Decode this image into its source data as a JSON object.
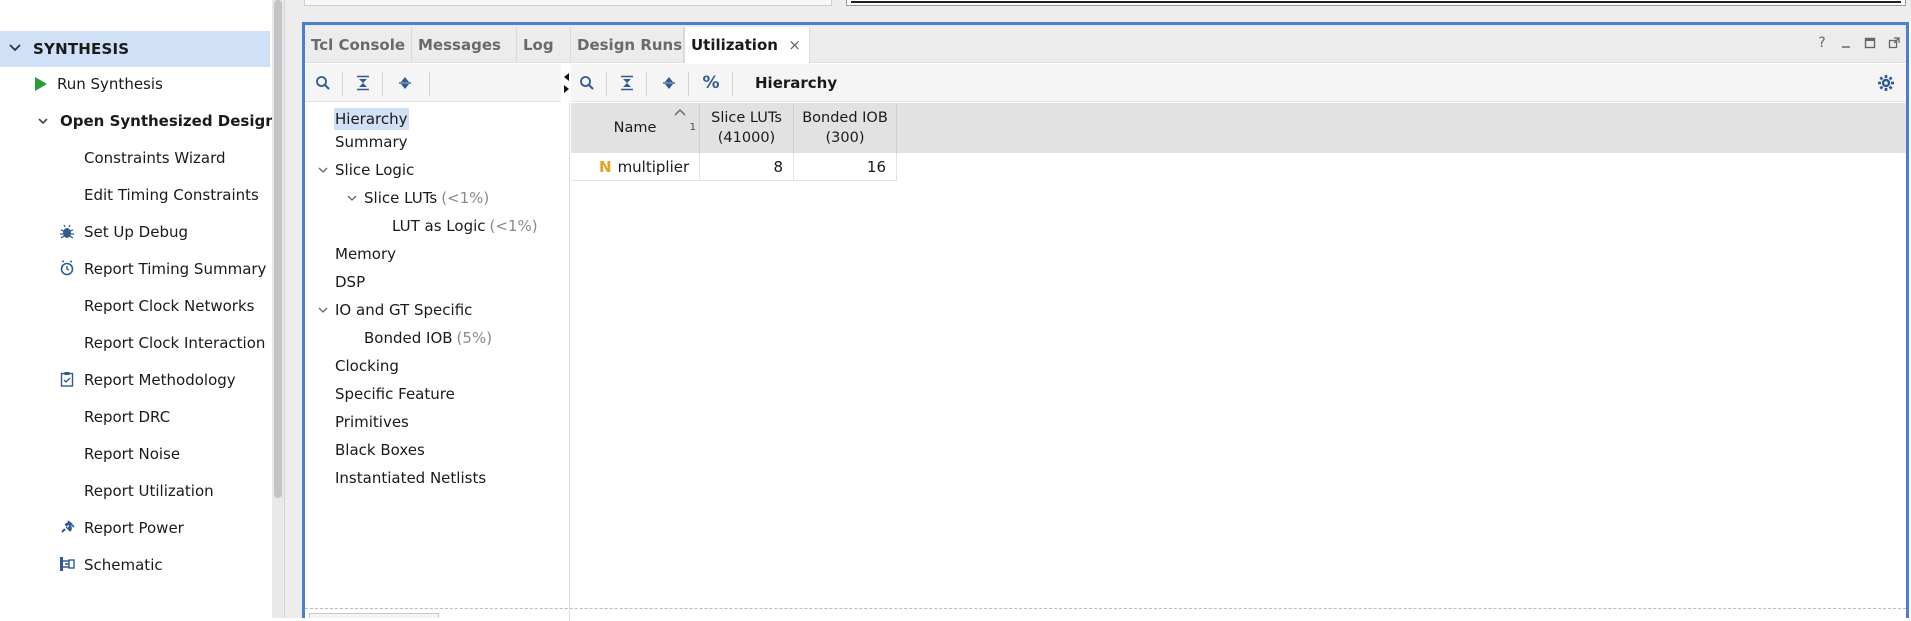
{
  "flow_navigator": {
    "section_title": "SYNTHESIS",
    "items": [
      {
        "label": "Run Synthesis",
        "icon": "run-icon"
      },
      {
        "label": "Open Synthesized Design",
        "icon": "chevron-down-icon"
      },
      {
        "label": "Constraints Wizard",
        "icon": ""
      },
      {
        "label": "Edit Timing Constraints",
        "icon": ""
      },
      {
        "label": "Set Up Debug",
        "icon": "bug-icon"
      },
      {
        "label": "Report Timing Summary",
        "icon": "clock-icon"
      },
      {
        "label": "Report Clock Networks",
        "icon": ""
      },
      {
        "label": "Report Clock Interaction",
        "icon": ""
      },
      {
        "label": "Report Methodology",
        "icon": "clipboard-icon"
      },
      {
        "label": "Report DRC",
        "icon": ""
      },
      {
        "label": "Report Noise",
        "icon": ""
      },
      {
        "label": "Report Utilization",
        "icon": ""
      },
      {
        "label": "Report Power",
        "icon": "power-icon"
      },
      {
        "label": "Schematic",
        "icon": "schematic-icon"
      }
    ]
  },
  "panel": {
    "tabs": [
      {
        "label": "Tcl Console",
        "active": false
      },
      {
        "label": "Messages",
        "active": false
      },
      {
        "label": "Log",
        "active": false
      },
      {
        "label": "Design Runs",
        "active": false
      },
      {
        "label": "Utilization",
        "active": true
      }
    ],
    "close_glyph": "×",
    "window_controls": [
      "?",
      "_",
      "□",
      "⇱"
    ],
    "right_toolbar": {
      "percent_label": "%",
      "view_title": "Hierarchy"
    },
    "tree": [
      {
        "label": "Hierarchy",
        "pct": "",
        "selected": true
      },
      {
        "label": "Summary",
        "pct": ""
      },
      {
        "label": "Slice Logic",
        "pct": ""
      },
      {
        "label": "Slice LUTs",
        "pct": "(<1%)"
      },
      {
        "label": "LUT as Logic",
        "pct": "(<1%)"
      },
      {
        "label": "Memory",
        "pct": ""
      },
      {
        "label": "DSP",
        "pct": ""
      },
      {
        "label": "IO and GT Specific",
        "pct": ""
      },
      {
        "label": "Bonded IOB",
        "pct": "(5%)"
      },
      {
        "label": "Clocking",
        "pct": ""
      },
      {
        "label": "Specific Feature",
        "pct": ""
      },
      {
        "label": "Primitives",
        "pct": ""
      },
      {
        "label": "Black Boxes",
        "pct": ""
      },
      {
        "label": "Instantiated Netlists",
        "pct": ""
      }
    ],
    "table": {
      "columns": [
        {
          "line1": "Name",
          "line2": "",
          "sort_index": "1"
        },
        {
          "line1": "Slice LUTs",
          "line2": "(41000)"
        },
        {
          "line1": "Bonded IOB",
          "line2": "(300)"
        }
      ],
      "rows": [
        {
          "badge": "N",
          "name": "multiplier",
          "slice_luts": "8",
          "bonded_iob": "16"
        }
      ]
    }
  },
  "colors": {
    "accent_border": "#4a7fd0",
    "selection": "#cfe0f7",
    "run_green": "#2a9d3a",
    "badge_orange": "#e8a020",
    "icon_blue": "#2f5b92"
  }
}
